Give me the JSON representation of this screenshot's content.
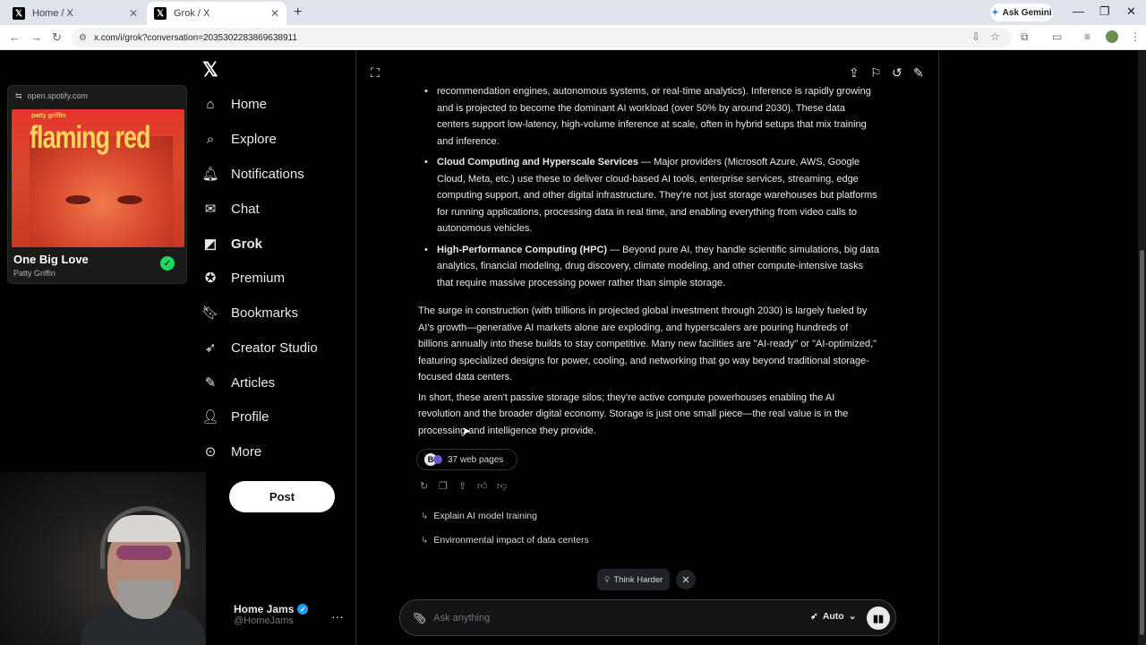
{
  "browser": {
    "tabs": [
      {
        "title": "Home / X",
        "active": false
      },
      {
        "title": "Grok / X",
        "active": true
      }
    ],
    "url": "x.com/i/grok?conversation=2035302283869638911",
    "ask_gemini": "Ask Gemini"
  },
  "spotify": {
    "source": "open.spotify.com",
    "album_artist": "patty griffin",
    "album_title": "flaming red",
    "song": "One Big Love",
    "artist": "Patty Griffin"
  },
  "sidebar": {
    "items": [
      {
        "label": "Home",
        "icon": "home-icon"
      },
      {
        "label": "Explore",
        "icon": "search-icon"
      },
      {
        "label": "Notifications",
        "icon": "bell-icon"
      },
      {
        "label": "Chat",
        "icon": "mail-icon"
      },
      {
        "label": "Grok",
        "icon": "grok-icon"
      },
      {
        "label": "Premium",
        "icon": "verified-icon"
      },
      {
        "label": "Bookmarks",
        "icon": "bookmark-icon"
      },
      {
        "label": "Creator Studio",
        "icon": "rocket-icon"
      },
      {
        "label": "Articles",
        "icon": "article-icon"
      },
      {
        "label": "Profile",
        "icon": "person-icon"
      },
      {
        "label": "More",
        "icon": "more-circle-icon"
      }
    ],
    "post_label": "Post",
    "account": {
      "name": "Home Jams",
      "handle": "@HomeJams"
    }
  },
  "conversation": {
    "partial_intro": "recommendation engines, autonomous systems, or real-time analytics). Inference is rapidly growing and is projected to become the dominant AI workload (over 50% by around 2030). These data centers support low-latency, high-volume inference at scale, often in hybrid setups that mix training and inference.",
    "bullets": [
      {
        "heading": "Cloud Computing and Hyperscale Services",
        "text": " — Major providers (Microsoft Azure, AWS, Google Cloud, Meta, etc.) use these to deliver cloud-based AI tools, enterprise services, streaming, edge computing support, and other digital infrastructure. They're not just storage warehouses but platforms for running applications, processing data in real time, and enabling everything from video calls to autonomous vehicles."
      },
      {
        "heading": "High-Performance Computing (HPC)",
        "text": " — Beyond pure AI, they handle scientific simulations, big data analytics, financial modeling, drug discovery, climate modeling, and other compute-intensive tasks that require massive processing power rather than simple storage."
      }
    ],
    "paragraph1": "The surge in construction (with trillions in projected global investment through 2030) is largely fueled by AI's growth—generative AI markets alone are exploding, and hyperscalers are pouring hundreds of billions annually into these builds to stay competitive. Many new facilities are \"AI-ready\" or \"AI-optimized,\" featuring specialized designs for power, cooling, and networking that go way beyond traditional storage-focused data centers.",
    "paragraph2": "In short, these aren't passive storage silos; they're active compute powerhouses enabling the AI revolution and the broader digital economy. Storage is just one small piece—the real value is in the processing and intelligence they provide.",
    "sources_label": "37 web pages",
    "suggestions": [
      "Explain AI model training",
      "Environmental impact of data centers"
    ]
  },
  "composer": {
    "think_harder": "Think Harder",
    "placeholder": "Ask anything",
    "mode": "Auto"
  }
}
